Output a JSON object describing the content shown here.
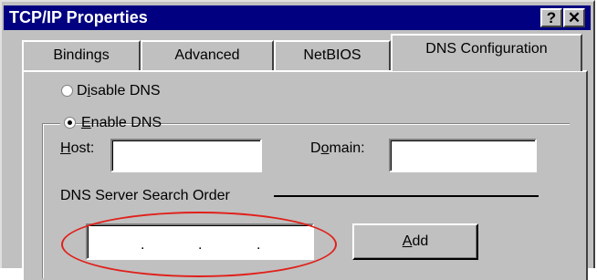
{
  "window": {
    "title": "TCP/IP Properties",
    "help_button": "?",
    "close_button": "✕"
  },
  "tabs": [
    {
      "label": "Bindings",
      "active": false
    },
    {
      "label": "Advanced",
      "active": false
    },
    {
      "label": "NetBIOS",
      "active": false
    },
    {
      "label": "DNS Configuration",
      "active": true
    }
  ],
  "dns": {
    "disable_prefix": "D",
    "disable_mnemonic": "i",
    "disable_rest": "sable DNS",
    "disable_selected": false,
    "enable_mnemonic": "E",
    "enable_rest": "nable DNS",
    "enable_selected": true,
    "host_mnemonic": "H",
    "host_rest": "ost:",
    "host_value": "",
    "domain_prefix": "D",
    "domain_mnemonic": "o",
    "domain_rest": "main:",
    "domain_value": "",
    "search_order_label": "DNS Server Search Order",
    "ip_separator": ".",
    "add_mnemonic": "A",
    "add_rest": "dd"
  },
  "annotation": {
    "color": "#e0201a"
  }
}
